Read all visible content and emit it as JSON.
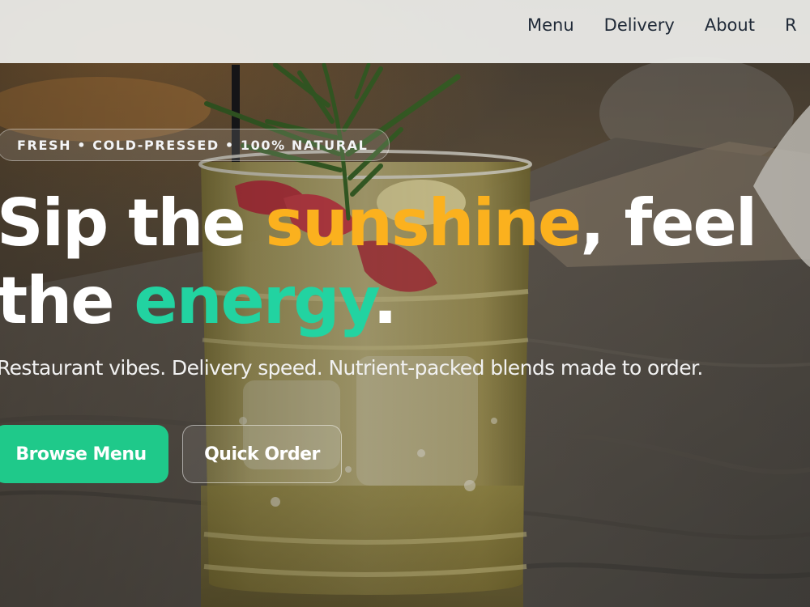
{
  "nav": {
    "items": [
      {
        "label": "Menu"
      },
      {
        "label": "Delivery"
      },
      {
        "label": "About"
      },
      {
        "label": "R"
      }
    ]
  },
  "hero": {
    "tagline": "FRESH • COLD-PRESSED • 100% NATURAL",
    "headline": {
      "part1": "Sip the ",
      "highlight1": "sunshine",
      "part2": ", feel",
      "part3": "the ",
      "highlight2": "energy",
      "part4": "."
    },
    "subheadline": "Restaurant vibes. Delivery speed. Nutrient-packed blends made to order.",
    "primary_cta": "Browse Menu",
    "secondary_cta": "Quick Order"
  },
  "colors": {
    "accent_yellow": "#fbb11e",
    "accent_green": "#22d3a1",
    "button_green": "#1fc98a",
    "nav_text": "#1f2937"
  }
}
